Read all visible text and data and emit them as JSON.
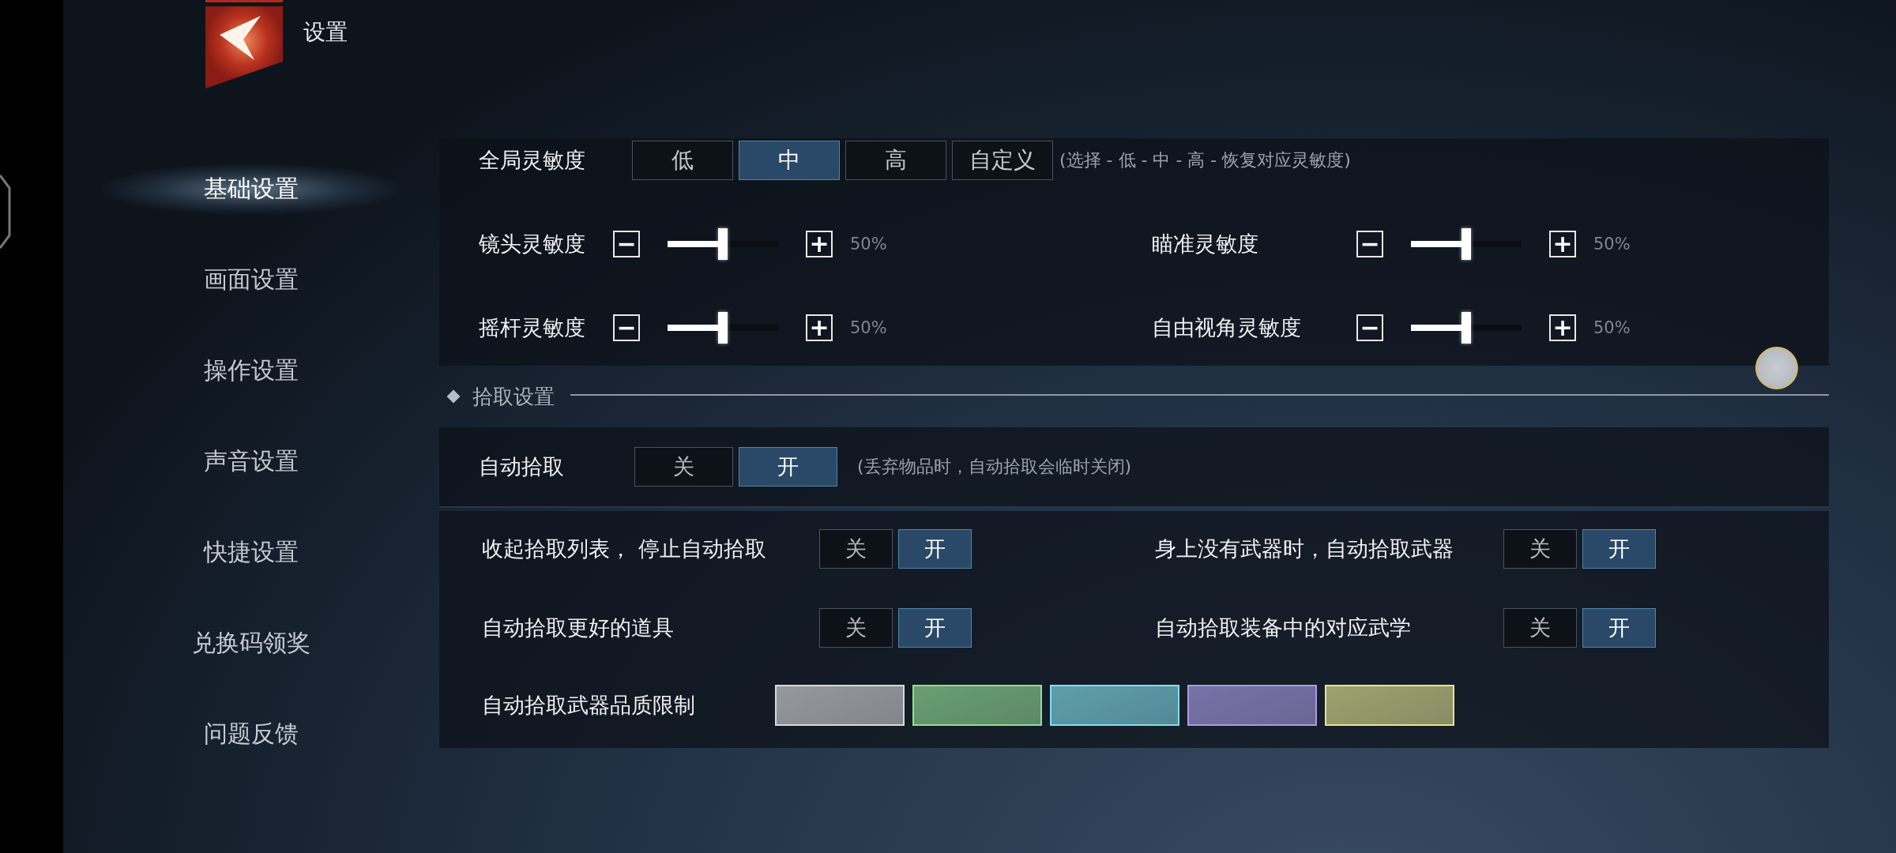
{
  "header": {
    "title": "设置"
  },
  "sidebar": {
    "items": [
      {
        "label": "基础设置",
        "selected": true
      },
      {
        "label": "画面设置",
        "selected": false
      },
      {
        "label": "操作设置",
        "selected": false
      },
      {
        "label": "声音设置",
        "selected": false
      },
      {
        "label": "快捷设置",
        "selected": false
      },
      {
        "label": "兑换码领奖",
        "selected": false
      },
      {
        "label": "问题反馈",
        "selected": false
      }
    ]
  },
  "global_sensitivity": {
    "label": "全局灵敏度",
    "hint": "(选择 - 低 - 中 - 高 - 恢复对应灵敏度)",
    "options": [
      {
        "label": "低",
        "selected": false
      },
      {
        "label": "中",
        "selected": true
      },
      {
        "label": "高",
        "selected": false
      },
      {
        "label": "自定义",
        "selected": false
      }
    ]
  },
  "sliders": [
    {
      "label": "镜头灵敏度",
      "minus": "−",
      "plus": "+",
      "level": 0.5,
      "reading": "50%"
    },
    {
      "label": "瞄准灵敏度",
      "minus": "−",
      "plus": "+",
      "level": 0.5,
      "reading": "50%"
    },
    {
      "label": "摇杆灵敏度",
      "minus": "−",
      "plus": "+",
      "level": 0.5,
      "reading": "50%"
    },
    {
      "label": "自由视角灵敏度",
      "minus": "−",
      "plus": "+",
      "level": 0.5,
      "reading": "50%"
    }
  ],
  "pickup": {
    "title": "拾取设置",
    "auto_pickup": {
      "label": "自动拾取",
      "off_label": "关",
      "on_label": "开",
      "on": true,
      "hint": "(丢弃物品时，自动拾取会临时关闭)"
    },
    "toggles": [
      {
        "label": "收起拾取列表， 停止自动拾取",
        "off_label": "关",
        "on_label": "开",
        "on": true
      },
      {
        "label": "身上没有武器时，自动拾取武器",
        "off_label": "关",
        "on_label": "开",
        "on": true
      },
      {
        "label": "自动拾取更好的道具",
        "off_label": "关",
        "on_label": "开",
        "on": true
      },
      {
        "label": "自动拾取装备中的对应武学",
        "off_label": "关",
        "on_label": "开",
        "on": true
      }
    ],
    "quality_limit": {
      "label": "自动拾取武器品质限制",
      "swatches": [
        {
          "color": "#d8d8d8"
        },
        {
          "color": "#8fe08f"
        },
        {
          "color": "#7ee0ee"
        },
        {
          "color": "#a89ae8"
        },
        {
          "color": "#e6e68a"
        }
      ]
    }
  }
}
